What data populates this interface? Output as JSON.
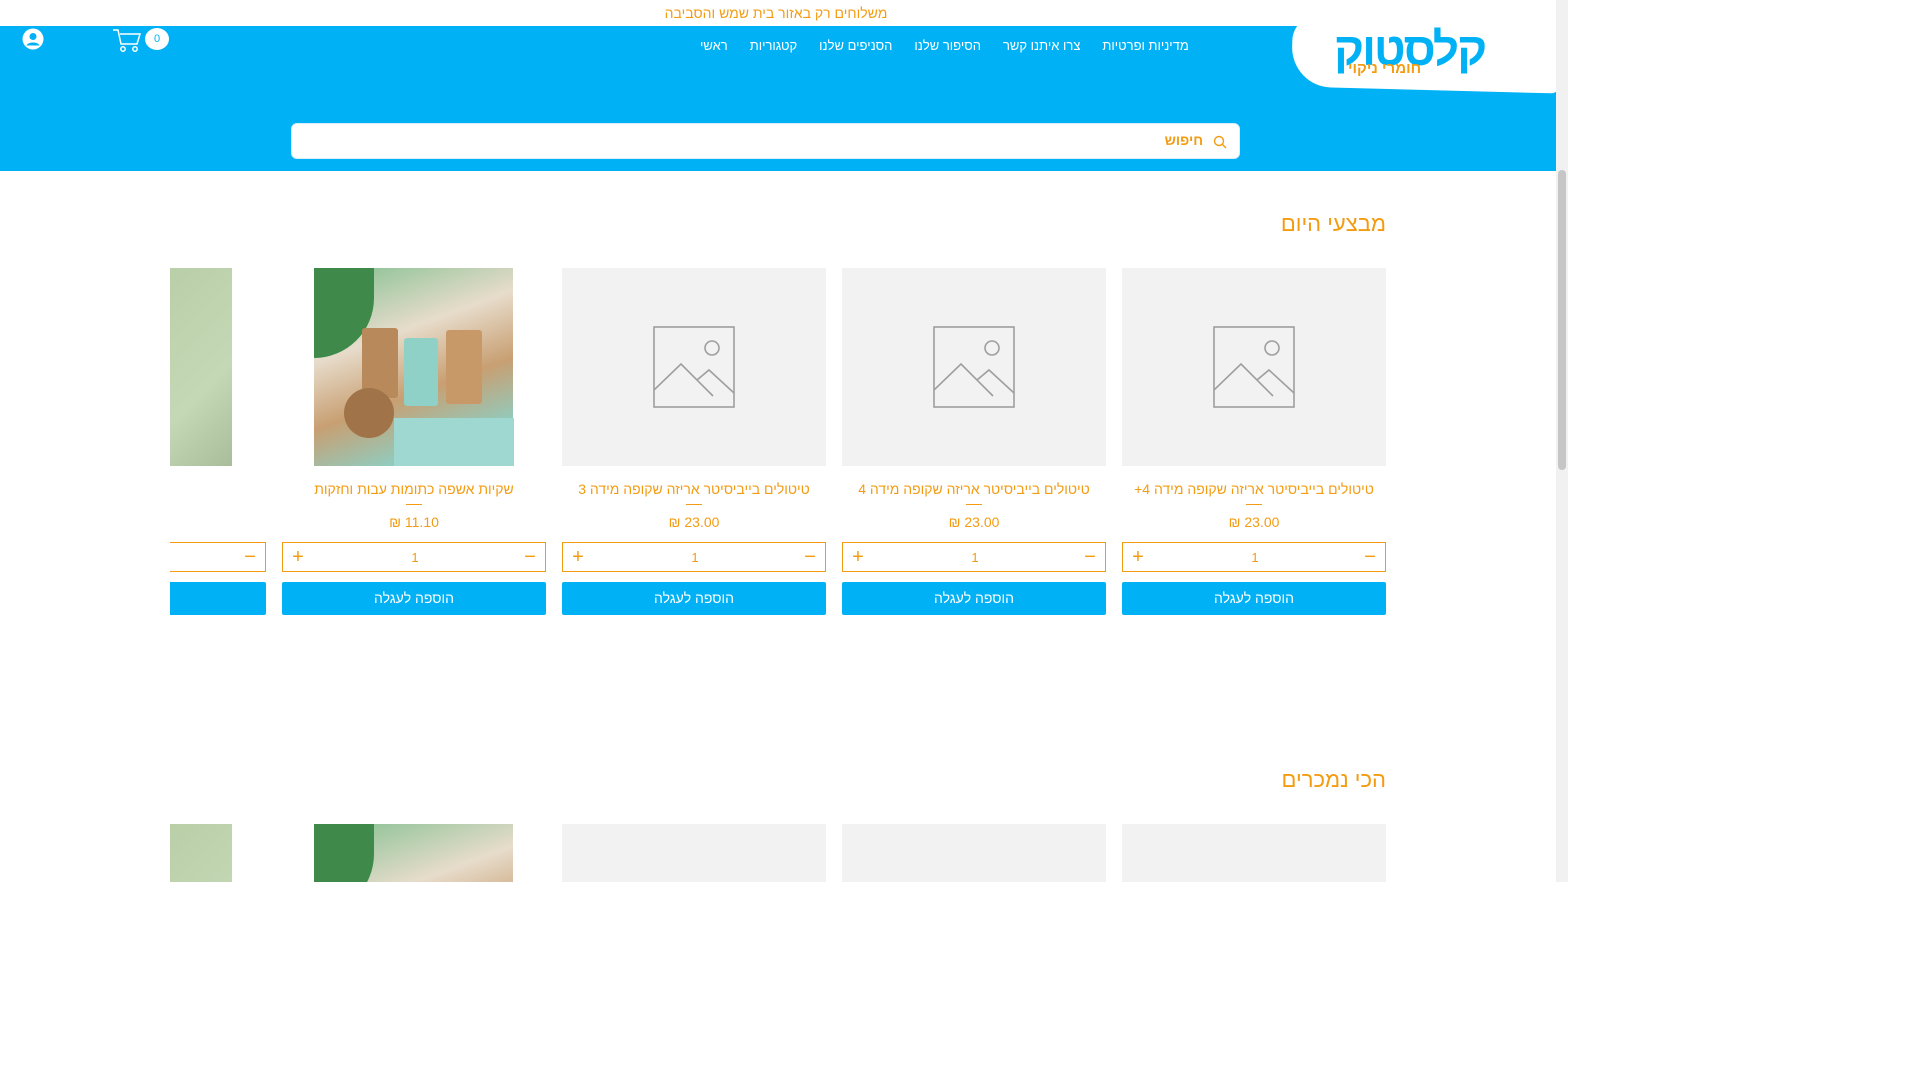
{
  "announcement": "משלוחים רק באזור בית שמש והסביבה",
  "logo": {
    "main": "קלסטוק",
    "sub": "חומרי ניקוי"
  },
  "nav": {
    "items": [
      "ראשי",
      "קטגוריות",
      "הסניפים שלנו",
      "הסיפור שלנו",
      "צרו איתנו קשר",
      "מדיניות ופרטיות"
    ]
  },
  "cart": {
    "count": "0"
  },
  "search": {
    "placeholder": "חיפוש"
  },
  "sections": {
    "deals": {
      "title": "מבצעי היום"
    },
    "best_sellers": {
      "title": "הכי נמכרים"
    }
  },
  "products": [
    {
      "title": "טיטולים בייביסיטר אריזה שקופה מידה 4+",
      "price": "23.00 ₪",
      "qty": "1",
      "add_label": "הוספה לעגלה",
      "image": "placeholder"
    },
    {
      "title": "טיטולים בייביסיטר אריזה שקופה מידה 4",
      "price": "23.00 ₪",
      "qty": "1",
      "add_label": "הוספה לעגלה",
      "image": "placeholder"
    },
    {
      "title": "טיטולים בייביסיטר אריזה שקופה מידה 3",
      "price": "23.00 ₪",
      "qty": "1",
      "add_label": "הוספה לעגלה",
      "image": "placeholder"
    },
    {
      "title": "שקיות אשפה כתומות עבות וחזקות",
      "price": "11.10 ₪",
      "qty": "1",
      "add_label": "הוספה לעגלה",
      "image": "eco-products-photo"
    }
  ],
  "colors": {
    "primary": "#00b2f5",
    "accent": "#f39c12",
    "placeholder_bg": "#f2f2f2"
  }
}
